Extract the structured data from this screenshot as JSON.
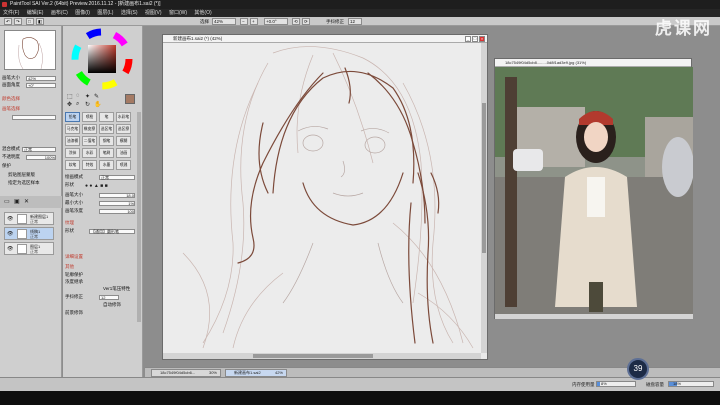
{
  "window": {
    "title": "PaintTool SAI  Ver.2 (64bit) Preview.2016.11.12 - [新建画布1.sai2 (*)]"
  },
  "menu": [
    "文件(F)",
    "编辑(E)",
    "画布(C)",
    "图像(I)",
    "图层(L)",
    "选择(S)",
    "视图(V)",
    "窗口(W)",
    "其他(O)"
  ],
  "toolbar": {
    "zoom_label": "选择",
    "zoom_value": "42%",
    "rotation_value": "+0.0°",
    "stabilizer_label": "手抖修正",
    "stabilizer_value": "12"
  },
  "watermark": "虎课网",
  "left_panel": {
    "brush_size_label": "画笔大小",
    "brush_size_value": "42%",
    "rotation_label": "画面角度",
    "rotation_value": "+0°",
    "section_color": "颜色选择",
    "section_mode": "画笔选择",
    "blend_label": "混合模式",
    "blend_value": "正常",
    "opacity_label": "不透明度",
    "opacity_value": "100%",
    "protect_label": "保护",
    "clip_label": "指定为选区样本",
    "clip2_label": "剪贴图层蒙版",
    "layers": [
      {
        "name": "新建图层1",
        "mode": "正常",
        "selected": false
      },
      {
        "name": "线稿1",
        "mode": "正常",
        "selected": true
      },
      {
        "name": "图层1",
        "mode": "正常",
        "selected": false
      }
    ]
  },
  "tools": {
    "items": [
      "铅笔",
      "喷枪",
      "笔",
      "水彩笔",
      "马克笔",
      "橡皮擦",
      "选区笔",
      "选区擦",
      "油漆桶",
      "二值笔",
      "钢笔",
      "模糊",
      "涂抹",
      "水彩",
      "笔刷",
      "油画",
      "软笔",
      "特效",
      "水墨",
      "喷溅"
    ],
    "active_index": 0,
    "blend_label": "绘画模式",
    "blend_value": "正常",
    "shape_label": "形状",
    "size_label": "画笔大小",
    "size_value": "18.0",
    "min_size_label": "最小大小",
    "min_size_value": "1%",
    "density_label": "画笔浓度",
    "density_value": "100",
    "texture_label": "纹理",
    "shape2_label": "形状",
    "shape2_value": "【通用】圆形笔",
    "section_detail": "详细设置",
    "section_adv": "其他",
    "option1": "轮廓保护",
    "option2": "浓度继承",
    "option3": "Ver1笔压特性",
    "stab_label": "手抖修正",
    "stab_value": "12",
    "option4": "自动修饰",
    "option5": "前景修饰"
  },
  "canvas_window": {
    "title": "新建画布1.sai2 (*) (42%)"
  },
  "ref_window": {
    "title": "18c7549f04d5cb8.........0d8f1ad3e9.jpg (31%)"
  },
  "doc_tabs": [
    {
      "label": "18c7549f04d5cb6...",
      "zoom": "30%",
      "active": false
    },
    {
      "label": "新建画布1.sai2",
      "zoom": "42%",
      "active": true
    }
  ],
  "status": {
    "memory_label": "内存使用量",
    "memory_value": "8%",
    "disk_label": "磁盘容量",
    "disk_value": "18%",
    "zoom_badge": "39"
  },
  "colors": {
    "accent": "#bcd3f0",
    "sketch": "#7c4a3a",
    "bg": "#8d8d8d"
  }
}
